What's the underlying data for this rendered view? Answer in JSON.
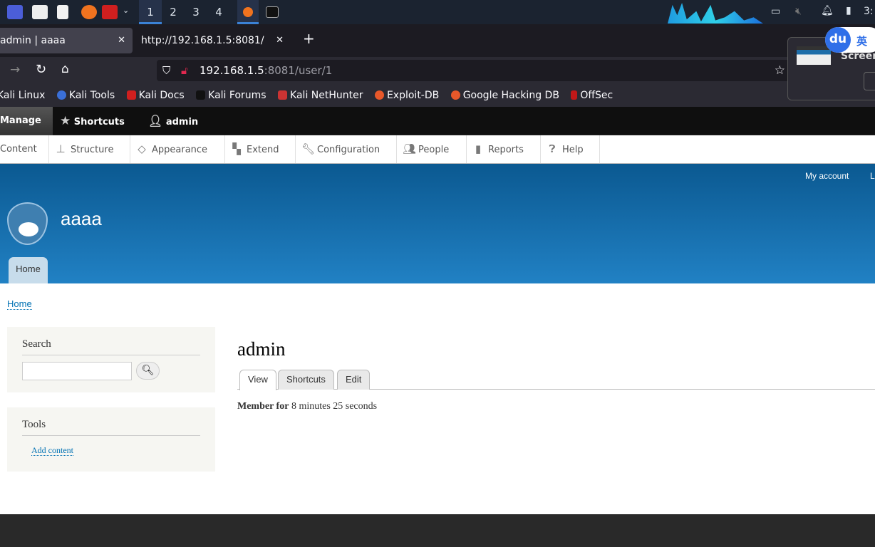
{
  "taskbar": {
    "workspaces": [
      "1",
      "2",
      "3",
      "4"
    ],
    "active_workspace": "1",
    "clock": "3:"
  },
  "browser": {
    "tabs": [
      {
        "title": "admin | aaaa",
        "active": true
      },
      {
        "title": "http://192.168.1.5:8081/",
        "active": false
      }
    ],
    "url_host": "192.168.1.5",
    "url_rest": ":8081/user/1",
    "bookmarks": [
      "Kali Linux",
      "Kali Tools",
      "Kali Docs",
      "Kali Forums",
      "Kali NetHunter",
      "Exploit-DB",
      "Google Hacking DB",
      "OffSec"
    ]
  },
  "notification": {
    "text": "Screens",
    "ime_badge": "du",
    "ime_lang": "英"
  },
  "toolbar": {
    "manage": "Manage",
    "shortcuts": "Shortcuts",
    "user": "admin"
  },
  "admin_menu": [
    {
      "label": "Content",
      "icon": "content-icon"
    },
    {
      "label": "Structure",
      "icon": "structure-icon"
    },
    {
      "label": "Appearance",
      "icon": "appearance-icon"
    },
    {
      "label": "Extend",
      "icon": "puzzle-icon"
    },
    {
      "label": "Configuration",
      "icon": "wrench-icon"
    },
    {
      "label": "People",
      "icon": "people-icon"
    },
    {
      "label": "Reports",
      "icon": "bar-chart-icon"
    },
    {
      "label": "Help",
      "icon": "help-icon"
    }
  ],
  "header": {
    "site_name": "aaaa",
    "secondary_menu": [
      "My account",
      "L"
    ],
    "primary_tab": "Home"
  },
  "breadcrumb": "Home",
  "sidebar": {
    "search_title": "Search",
    "search_value": "",
    "tools_title": "Tools",
    "tools_link": "Add content"
  },
  "main": {
    "title": "admin",
    "tabs": [
      "View",
      "Shortcuts",
      "Edit"
    ],
    "active_tab": "View",
    "member_label": "Member for",
    "member_value": "8 minutes 25 seconds"
  },
  "colors": {
    "header_top": "#0b5991",
    "header_bottom": "#2181c4",
    "link": "#0071b3"
  }
}
